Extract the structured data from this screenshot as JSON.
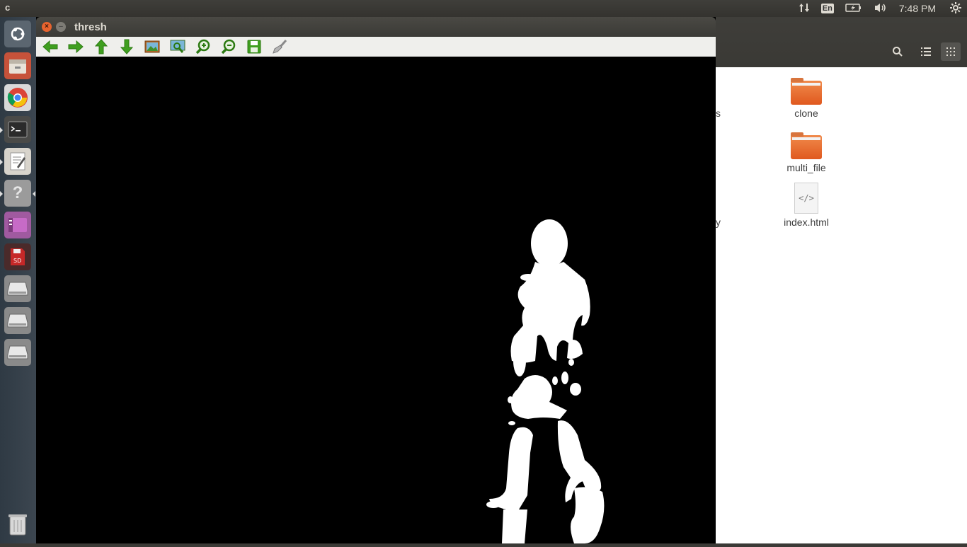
{
  "topbar": {
    "app_letter": "c",
    "lang": "En",
    "clock": "7:48 PM"
  },
  "window": {
    "title": "thresh",
    "toolbar": [
      "back-icon",
      "forward-icon",
      "up-icon",
      "down-icon",
      "image-icon",
      "zoom-fit-icon",
      "zoom-in-icon",
      "zoom-out-icon",
      "save-icon",
      "brush-icon"
    ]
  },
  "file_manager": {
    "items": [
      {
        "name": "clone",
        "type": "folder"
      },
      {
        "name": "multi_file",
        "type": "folder"
      },
      {
        "name": "index.html",
        "type": "html"
      }
    ],
    "clipped_letters": [
      "s",
      "y"
    ]
  },
  "launcher": [
    "ubuntu-dash-icon",
    "files-icon",
    "chrome-icon",
    "terminal-icon",
    "text-editor-icon",
    "help-icon",
    "software-center-icon",
    "sd-card-icon",
    "drive-icon",
    "drive-icon",
    "drive-icon",
    "trash-icon"
  ],
  "colors": {
    "accent": "#e8632e",
    "folder": "#e0591f",
    "toolbar_green": "#3f9f1f"
  }
}
